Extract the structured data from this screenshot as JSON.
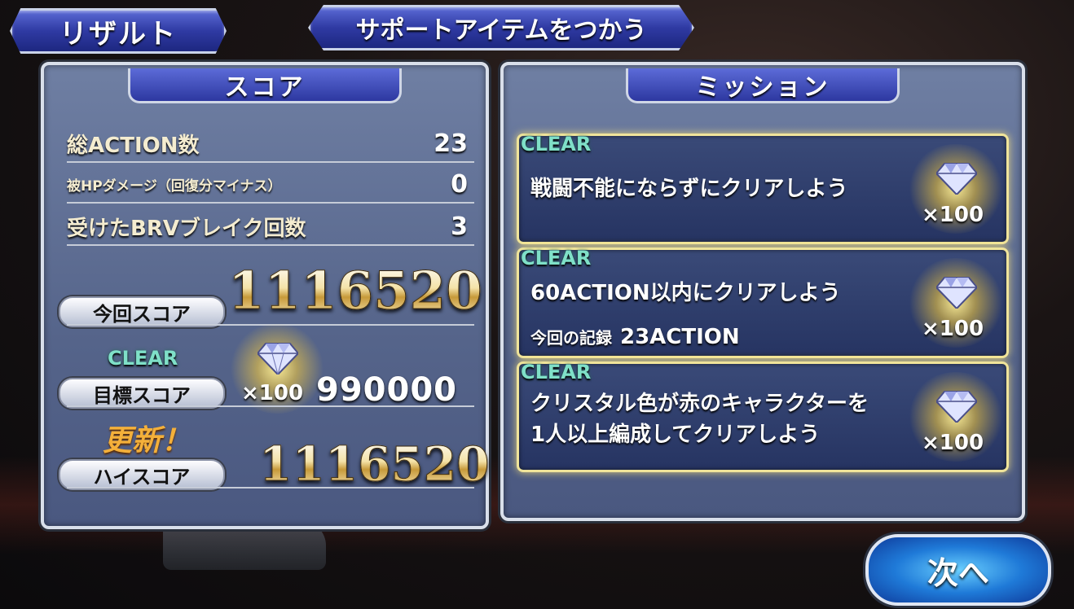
{
  "tabs": {
    "result": "リザルト",
    "support_items": "サポートアイテムをつかう"
  },
  "score_panel": {
    "title": "スコア",
    "stats": [
      {
        "label": "総ACTION数",
        "value": "23"
      },
      {
        "label": "被HPダメージ（回復分マイナス）",
        "value": "0"
      },
      {
        "label": "受けたBRVブレイク回数",
        "value": "3"
      }
    ],
    "current_score": {
      "label": "今回スコア",
      "value": "1116520"
    },
    "target_score": {
      "clear_tag": "CLEAR",
      "label": "目標スコア",
      "reward": "×100",
      "value": "990000"
    },
    "high_score": {
      "update_tag": "更新！",
      "label": "ハイスコア",
      "value": "1116520"
    }
  },
  "mission_panel": {
    "title": "ミッション",
    "missions": [
      {
        "clear_tag": "CLEAR",
        "text_lines": [
          "戦闘不能にならずにクリアしよう"
        ],
        "reward": "×100"
      },
      {
        "clear_tag": "CLEAR",
        "text_lines": [
          "60ACTION以内にクリアしよう"
        ],
        "record_label": "今回の記録",
        "record_value": "23ACTION",
        "reward": "×100"
      },
      {
        "clear_tag": "CLEAR",
        "text_lines": [
          "クリスタル色が赤のキャラクターを",
          "1人以上編成してクリアしよう"
        ],
        "reward": "×100"
      }
    ]
  },
  "next_button": "次へ",
  "icons": [
    "crystal-gem-icon"
  ],
  "colors": {
    "accent_blue": "#2f3aa3",
    "clear_teal": "#7fe0c8",
    "gold": "#f4b03a"
  }
}
